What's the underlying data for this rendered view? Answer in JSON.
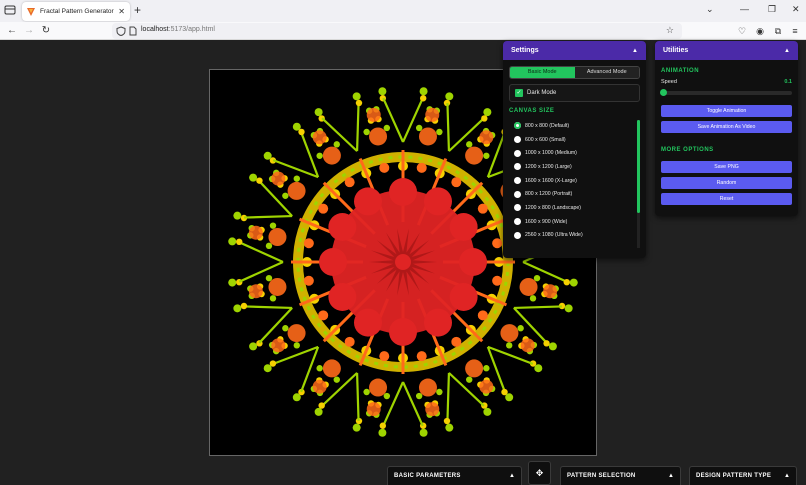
{
  "browser": {
    "tab_title": "Fractal Pattern Generator",
    "tab_close": "✕",
    "new_tab": "+",
    "url_host": "localhost",
    "url_rest": ":5173/app.html",
    "icons": [
      "sidebar-icon",
      "favicon-icon",
      "back-icon",
      "forward-icon",
      "reload-icon",
      "shield-icon",
      "page-icon",
      "star-icon",
      "pocket-icon",
      "account-icon",
      "extensions-icon",
      "menu-icon"
    ]
  },
  "settings": {
    "title": "Settings",
    "collapse": "▲",
    "modes": [
      "Basic Mode",
      "Advanced Mode"
    ],
    "active_mode": "Basic Mode",
    "dark_mode_label": "Dark Mode",
    "dark_mode_checked": true,
    "canvas_size_heading": "CANVAS SIZE",
    "canvas_sizes": [
      "800 x 800 (Default)",
      "600 x 600 (Small)",
      "1000 x 1000 (Medium)",
      "1200 x 1200 (Large)",
      "1600 x 1600 (X-Large)",
      "800 x 1200 (Portrait)",
      "1200 x 800 (Landscape)",
      "1600 x 900 (Wide)",
      "2560 x 1080 (Ultra Wide)"
    ],
    "selected_size_index": 0
  },
  "utilities": {
    "title": "Utilities",
    "collapse": "▲",
    "animation_heading": "ANIMATION",
    "speed_label": "Speed",
    "speed_value": "0.1",
    "speed_fraction": 0.02,
    "toggle_animation": "Toggle Animation",
    "save_video": "Save Animation As Video",
    "more_options_heading": "MORE OPTIONS",
    "save_png": "Save PNG",
    "random": "Random",
    "reset": "Reset"
  },
  "bottom": {
    "basic_parameters": "BASIC PARAMETERS",
    "pattern_selection": "PATTERN SELECTION",
    "design_pattern_type": "DESIGN PATTERN TYPE",
    "caret": "▲",
    "move_glyph": "✥"
  },
  "colors": {
    "accent_green": "#22c55e",
    "header_purple": "#4b2aa8",
    "button_indigo": "#5b5bf0",
    "fractal_red": "#e02424",
    "fractal_orange": "#ff6a1a",
    "fractal_yellow": "#f5d000",
    "fractal_green": "#9fd400"
  }
}
